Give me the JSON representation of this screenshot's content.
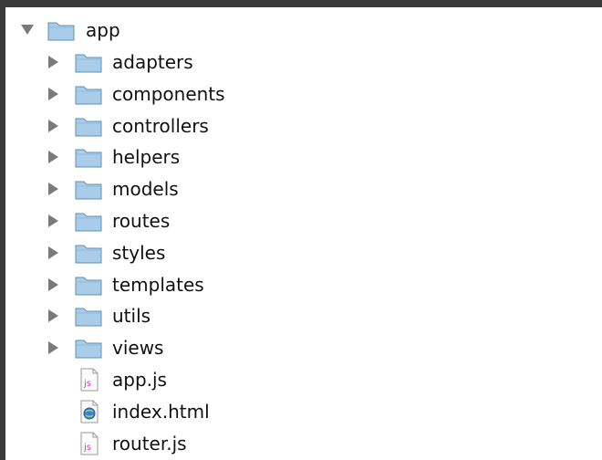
{
  "tree": {
    "root": {
      "label": "app",
      "expanded": true,
      "icon": "folder-icon"
    },
    "children": [
      {
        "label": "adapters",
        "type": "folder",
        "icon": "folder-icon"
      },
      {
        "label": "components",
        "type": "folder",
        "icon": "folder-icon"
      },
      {
        "label": "controllers",
        "type": "folder",
        "icon": "folder-icon"
      },
      {
        "label": "helpers",
        "type": "folder",
        "icon": "folder-icon"
      },
      {
        "label": "models",
        "type": "folder",
        "icon": "folder-icon"
      },
      {
        "label": "routes",
        "type": "folder",
        "icon": "folder-icon"
      },
      {
        "label": "styles",
        "type": "folder",
        "icon": "folder-icon"
      },
      {
        "label": "templates",
        "type": "folder",
        "icon": "folder-icon"
      },
      {
        "label": "utils",
        "type": "folder",
        "icon": "folder-icon"
      },
      {
        "label": "views",
        "type": "folder",
        "icon": "folder-icon"
      },
      {
        "label": "app.js",
        "type": "file",
        "icon": "js-file-icon",
        "badge": "js"
      },
      {
        "label": "index.html",
        "type": "file",
        "icon": "html-file-icon"
      },
      {
        "label": "router.js",
        "type": "file",
        "icon": "js-file-icon",
        "badge": "js"
      }
    ]
  },
  "colors": {
    "background": "#3a3a3a",
    "panel": "#ffffff",
    "folder": "#a9cde8",
    "folder_outline": "#5f8fb3",
    "disclosure": "#7a7a7a",
    "js_badge": "#c93cc3"
  }
}
